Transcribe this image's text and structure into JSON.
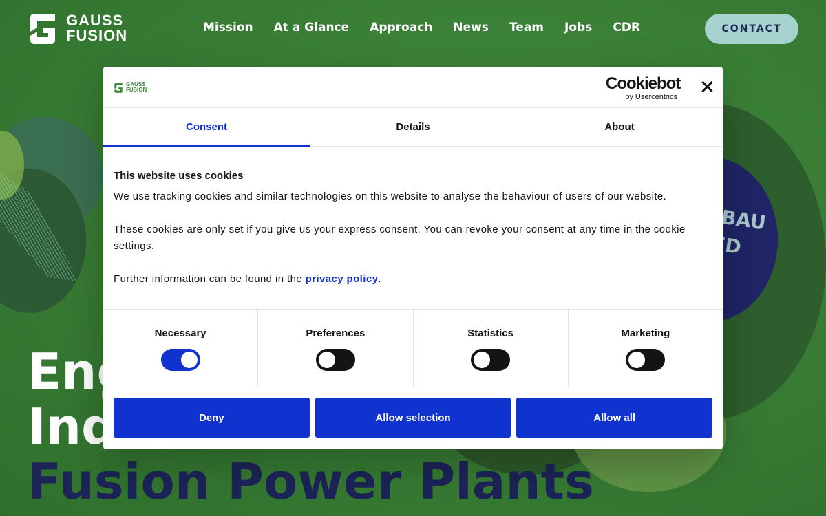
{
  "header": {
    "logo_text_line1": "GAUSS",
    "logo_text_line2": "FUSION",
    "nav": [
      "Mission",
      "At a Glance",
      "Approach",
      "News",
      "Team",
      "Jobs",
      "CDR"
    ],
    "contact_label": "CONTACT"
  },
  "background": {
    "badge_line1": "BAU",
    "badge_line2": "ED"
  },
  "hero": {
    "line1": "Eng",
    "line2": "Ind",
    "line3": "Fusion Power Plants"
  },
  "cookie_dialog": {
    "mini_logo_line1": "GAUSS",
    "mini_logo_line2": "FUSION",
    "brand": "Cookiebot",
    "brand_sub": "by Usercentrics",
    "tabs": [
      "Consent",
      "Details",
      "About"
    ],
    "active_tab": "Consent",
    "heading": "This website uses cookies",
    "paragraph1": "We use tracking cookies and similar technologies on this website to analyse the behaviour of users of our website.",
    "paragraph2": "These cookies are only set if you give us your express consent. You can revoke your consent at any time in the cookie settings.",
    "paragraph3_prefix": "Further information can be found in the ",
    "paragraph3_link": "privacy policy",
    "paragraph3_suffix": ".",
    "toggles": [
      {
        "label": "Necessary",
        "on": true
      },
      {
        "label": "Preferences",
        "on": false
      },
      {
        "label": "Statistics",
        "on": false
      },
      {
        "label": "Marketing",
        "on": false
      }
    ],
    "buttons": {
      "deny": "Deny",
      "allow_selection": "Allow selection",
      "allow_all": "Allow all"
    }
  },
  "colors": {
    "accent": "#1032cf",
    "background_green": "#3a7f36",
    "navy": "#1c2458",
    "contact_bg": "#a7d3cf"
  },
  "icons": [
    "gauss-fusion-logo-icon",
    "close-icon"
  ]
}
